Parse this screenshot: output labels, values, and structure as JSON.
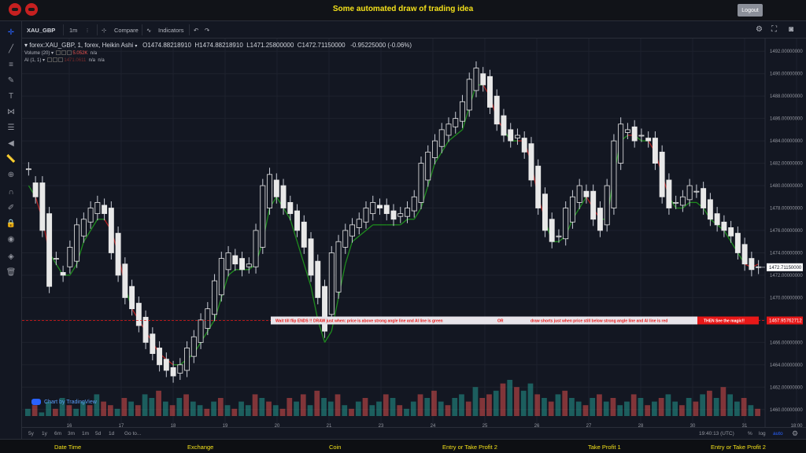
{
  "app": {
    "title": "Some automated draw of trading idea",
    "logout_label": "Logout"
  },
  "toolbar": {
    "symbol": "XAU_GBP",
    "interval": "1m",
    "compare_label": "Compare",
    "indicators_label": "Indicators"
  },
  "legend": {
    "title": "forex:XAU_GBP, 1, forex, Heikin Ashi",
    "open": "O1474.88218910",
    "high": "H1474.88218910",
    "low": "L1471.25800000",
    "close": "C1472.71150000",
    "change": "-0.95225000 (-0.06%)",
    "volume_label": "Volume (20)",
    "volume_value": "5.052K",
    "volume_na": "n/a",
    "ai_label": "AI (1, 1)",
    "ai_value1": "1471.0611",
    "ai_na1": "n/a",
    "ai_na2": "n/a"
  },
  "watermark": "Chart by TradingView",
  "price_axis": [
    "1492.00000000",
    "1490.00000000",
    "1488.00000000",
    "1486.00000000",
    "1484.00000000",
    "1482.00000000",
    "1480.00000000",
    "1478.00000000",
    "1476.00000000",
    "1474.00000000",
    "1472.00000000",
    "1470.00000000",
    "1468.00000000",
    "1466.00000000",
    "1464.00000000",
    "1462.00000000",
    "1460.00000000"
  ],
  "current_price": "1472.71150000",
  "marker_price": "1467.95762712",
  "time_axis": [
    "16",
    "17",
    "18",
    "19",
    "20",
    "21",
    "23",
    "24",
    "25",
    "26",
    "27",
    "28",
    "30",
    "31",
    "18:00"
  ],
  "annotation": {
    "segments": [
      "Wait till flip ENDS !!",
      "DRAW just when:  price is above strong angle line and AI line is green",
      "OR",
      "draw shorts just when price still below strong angle line and AI line is red"
    ],
    "callout": "THEN See the magic!!"
  },
  "bottombar": {
    "ranges": [
      "5y",
      "1y",
      "6m",
      "3m",
      "1m",
      "5d",
      "1d"
    ],
    "goto": "Go to...",
    "time": "19:40:13 (UTC)",
    "percent": "%",
    "log": "log",
    "auto": "auto"
  },
  "footer": [
    "Date Time",
    "Exchange",
    "Coin",
    "Entry or Take Profit 2",
    "Take Profit 1",
    "Entry or Take Profit 2"
  ],
  "colors": {
    "background": "#131722",
    "title_yellow": "#f4e11a",
    "ai_green": "#1e8c1e",
    "ai_red": "#b22222",
    "annotation_red": "#e81818",
    "volume_up": "#26a69a",
    "volume_down": "#ef5350"
  },
  "chart_data": {
    "type": "line",
    "ylim": [
      1459,
      1493
    ],
    "closes": [
      1481.5,
      1479,
      1476,
      1471,
      1473.5,
      1472,
      1474.5,
      1476.5,
      1477,
      1478,
      1478.5,
      1477.5,
      1474,
      1472,
      1470,
      1469,
      1467.5,
      1466,
      1465,
      1464,
      1463.5,
      1463,
      1464,
      1465.5,
      1466.5,
      1468,
      1469,
      1471.5,
      1473.5,
      1474,
      1473,
      1472.5,
      1473,
      1476,
      1480,
      1481,
      1479,
      1478,
      1477.5,
      1476,
      1474.5,
      1472,
      1470,
      1467,
      1474,
      1475,
      1476,
      1476.5,
      1477,
      1478,
      1478.5,
      1478,
      1477.5,
      1477,
      1477.5,
      1478,
      1479,
      1482,
      1483,
      1484,
      1485,
      1485.5,
      1486,
      1487.5,
      1489.5,
      1490.5,
      1489,
      1487,
      1485.5,
      1484.5,
      1484,
      1484.5,
      1483,
      1480.5,
      1478,
      1476,
      1475,
      1475.5,
      1478,
      1479,
      1480,
      1479,
      1477,
      1476,
      1480,
      1484,
      1485.5,
      1485,
      1484,
      1484.5,
      1484,
      1482,
      1479,
      1478,
      1478.5,
      1479,
      1480,
      1479.5,
      1478,
      1477,
      1476.5,
      1476,
      1475.5,
      1474,
      1473,
      1472.5,
      1472.7
    ],
    "ai_line": [
      1480,
      1479,
      1477,
      1474,
      1473,
      1472,
      1472,
      1473,
      1475,
      1476,
      1477,
      1477,
      1476,
      1474,
      1471,
      1469,
      1468,
      1467,
      1466,
      1465,
      1464.5,
      1464,
      1464,
      1464.5,
      1465,
      1466,
      1467,
      1468,
      1470,
      1472,
      1472.5,
      1472.5,
      1472.5,
      1473,
      1475,
      1478,
      1479,
      1478,
      1477,
      1475,
      1473,
      1471,
      1468,
      1466,
      1467,
      1470,
      1473,
      1475,
      1475.5,
      1476,
      1476.5,
      1476.5,
      1476.5,
      1476.5,
      1476.5,
      1477,
      1477,
      1478,
      1480,
      1482,
      1483,
      1484,
      1484.5,
      1485,
      1487,
      1489,
      1489,
      1488,
      1486,
      1485,
      1484,
      1484,
      1484,
      1482,
      1479,
      1477,
      1475,
      1475,
      1475.5,
      1477,
      1478,
      1479,
      1478,
      1477,
      1477,
      1481,
      1484,
      1484.5,
      1484.5,
      1484,
      1484,
      1483,
      1481,
      1479,
      1478,
      1478,
      1478.5,
      1478.5,
      1478,
      1477,
      1476.5,
      1476,
      1475,
      1474,
      1473,
      1472.7,
      1473
    ],
    "volumes": [
      2,
      3,
      1,
      4,
      2,
      5,
      3,
      2,
      4,
      3,
      6,
      4,
      3,
      2,
      5,
      4,
      3,
      6,
      5,
      7,
      4,
      3,
      5,
      6,
      4,
      3,
      2,
      4,
      5,
      3,
      2,
      4,
      3,
      6,
      5,
      4,
      3,
      2,
      5,
      4,
      6,
      3,
      7,
      5,
      4,
      6,
      3,
      2,
      4,
      5,
      3,
      4,
      6,
      5,
      3,
      2,
      4,
      6,
      5,
      7,
      4,
      3,
      5,
      6,
      4,
      8,
      5,
      6,
      7,
      9,
      10,
      8,
      7,
      9,
      6,
      5,
      4,
      6,
      7,
      5,
      4,
      3,
      5,
      6,
      4,
      5,
      3,
      4,
      6,
      5,
      3,
      4,
      5,
      6,
      4,
      3,
      5,
      4,
      6,
      7,
      5,
      8,
      6,
      4,
      5,
      3,
      2
    ],
    "volume_up_flags": [
      1,
      0,
      1,
      1,
      0,
      1,
      0,
      1,
      1,
      0,
      1,
      0,
      0,
      1,
      0,
      1,
      0,
      1,
      1,
      0,
      1,
      0,
      1,
      0,
      1,
      1,
      0,
      1,
      0,
      1,
      0,
      1,
      1,
      0,
      1,
      0,
      1,
      0,
      0,
      1,
      0,
      1,
      0,
      1,
      1,
      0,
      1,
      0,
      1,
      0,
      1,
      1,
      0,
      1,
      0,
      1,
      1,
      0,
      1,
      0,
      1,
      0,
      1,
      1,
      0,
      1,
      0,
      0,
      1,
      0,
      1,
      0,
      1,
      1,
      0,
      1,
      0,
      1,
      0,
      1,
      1,
      0,
      1,
      0,
      1,
      0,
      1,
      1,
      0,
      1,
      0,
      1,
      0,
      1,
      1,
      0,
      1,
      0,
      1,
      0,
      1,
      0,
      1,
      1,
      0,
      1,
      0
    ]
  }
}
